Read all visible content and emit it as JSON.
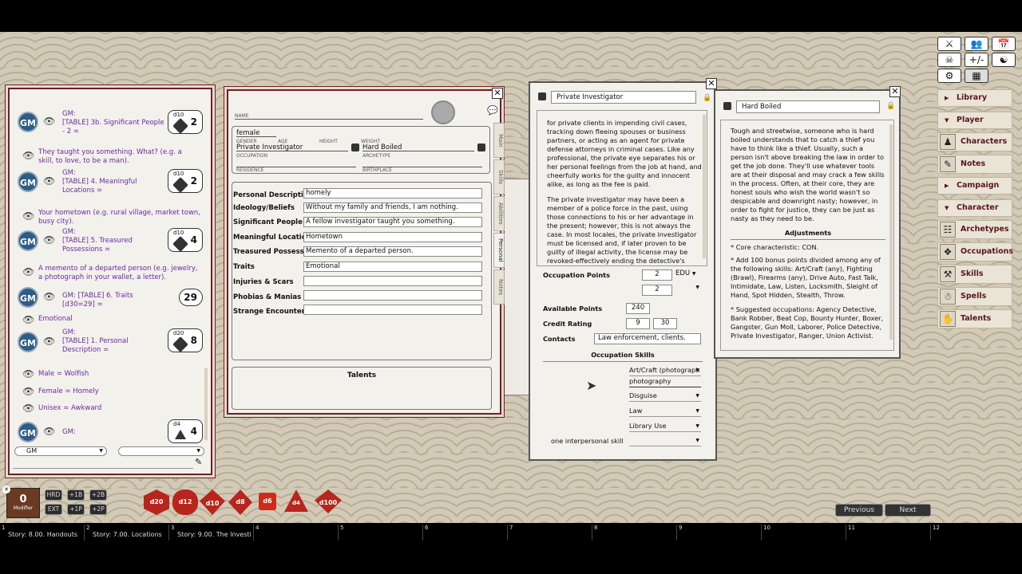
{
  "chat": {
    "lines": [
      {
        "speaker": "GM:",
        "text": "[TABLE] 3b. Significant People - 2 ="
      },
      {
        "text": "They taught you something. What? (e.g. a skill, to love, to be a man)."
      },
      {
        "speaker": "GM:",
        "text": "[TABLE] 4. Meaningful Locations ="
      },
      {
        "text": "Your hometown (e.g. rural village, market town, busy city)."
      },
      {
        "speaker": "GM:",
        "text": "[TABLE] 5. Treasured Possessions ="
      },
      {
        "text": "A memento of a departed person (e.g. jewelry, a photograph in your wallet, a letter)."
      },
      {
        "speaker": "GM:",
        "text": "[TABLE] 6. Traits [d30=29] ="
      },
      {
        "text": "Emotional"
      },
      {
        "speaker": "GM:",
        "text": "[TABLE] 1. Personal Description ="
      },
      {
        "text": "Male = Wolfish"
      },
      {
        "text": "Female = Homely"
      },
      {
        "text": "Unisex = Awkward"
      },
      {
        "speaker": "GM:",
        "text": ""
      }
    ],
    "dice": [
      {
        "die": "d10",
        "value": "2"
      },
      {
        "die": "d10",
        "value": "2"
      },
      {
        "die": "d10",
        "value": "4"
      },
      {
        "die": "",
        "value": "29"
      },
      {
        "die": "d20",
        "value": "8"
      },
      {
        "die": "d4",
        "value": "4"
      }
    ],
    "gm_badge": "GM",
    "identity_select": "GM",
    "mode_select": ""
  },
  "sheet": {
    "name_label": "NAME",
    "gender": "female",
    "gender_label": "GENDER",
    "age_label": "AGE",
    "height_label": "HEIGHT",
    "weight_label": "WEIGHT",
    "occupation": "Private Investigator",
    "occupation_label": "OCCUPATION",
    "archetype": "Hard Boiled",
    "archetype_label": "ARCHETYPE",
    "residence_label": "RESIDENCE",
    "birthplace_label": "BIRTHPLACE",
    "tabs": [
      "Main",
      "Skills",
      "Abilities",
      "Personal",
      "Notes"
    ],
    "rows": [
      {
        "label": "Personal Description",
        "value": "homely"
      },
      {
        "label": "Ideology/Beliefs",
        "value": "Without my family and friends, I am nothing."
      },
      {
        "label": "Significant People",
        "value": "A fellow investigator taught you something."
      },
      {
        "label": "Meaningful Locations",
        "value": "Hometown"
      },
      {
        "label": "Treasured Possessions",
        "value": "Memento of a departed person."
      },
      {
        "label": "Traits",
        "value": "Emotional"
      },
      {
        "label": "Injuries & Scars",
        "value": ""
      },
      {
        "label": "Phobias & Manias",
        "value": ""
      },
      {
        "label": "Strange Encounters",
        "value": ""
      }
    ],
    "talents_title": "Talents"
  },
  "occupation": {
    "title": "Private Investigator",
    "para1": "for private clients in impending civil cases, tracking down fleeing spouses or business partners, or acting as an agent for private defense attorneys in criminal cases. Like any professional, the private eye separates his or her personal feelings from the job at hand, and cheerfully works for the guilty and innocent alike, as long as the fee is paid.",
    "para2": "The private investigator may have been a member of a police force in the past, using those connections to his or her advantage in the present; however, this is not always the case. In most locales, the private investigator must be licensed and, if later proven to be guilty of illegal activity, the license may be revoked-effectively ending the detective's career.",
    "occ_points_label": "Occupation Points",
    "occ_points_a": "2",
    "occ_points_a_stat": "EDU",
    "occ_points_b": "2",
    "occ_points_b_stat": "",
    "available_label": "Available Points",
    "available": "240",
    "credit_label": "Credit Rating",
    "credit_min": "9",
    "credit_max": "30",
    "contacts_label": "Contacts",
    "contacts": "Law enforcement, clients.",
    "skills_title": "Occupation Skills",
    "skills": [
      "Art/Craft (photograph",
      "photography",
      "Disguise",
      "Law",
      "Library Use"
    ],
    "interpersonal": "one interpersonal skill"
  },
  "archetype": {
    "title": "Hard Boiled",
    "desc": "Tough and streetwise, someone who is hard boiled understands that to catch a thief you have to think like a thief. Usually, such a person isn't above breaking the law in order to get the job done. They'll use whatever tools are at their disposal and may crack a few skills in the process. Often, at their core, they are honest souls who wish the world wasn't so despicable and downright nasty; however, in order to fight for justice, they can be just as nasty as they need to be.",
    "adj_title": "Adjustments",
    "adj1": "* Core characteristic: CON.",
    "adj2": "* Add 100 bonus points divided among any of the following skills: Art/Craft (any), Fighting (Brawl), Firearms (any), Drive Auto, Fast Talk, Intimidate, Law, Listen, Locksmith, Sleight of Hand, Spot Hidden, Stealth, Throw.",
    "adj3": "* Suggested occupations: Agency Detective, Bank Robber, Beat Cop, Bounty Hunter, Boxer, Gangster, Gun Moll, Laborer, Police Detective, Private Investigator, Ranger, Union Activist."
  },
  "sidebar": {
    "sections": [
      "Library",
      "Player",
      "Campaign",
      "Character"
    ],
    "player_items": [
      {
        "label": "Characters",
        "icon": "people-icon"
      },
      {
        "label": "Notes",
        "icon": "notes-icon"
      }
    ],
    "character_items": [
      {
        "label": "Archetypes",
        "icon": "archetype-icon"
      },
      {
        "label": "Occupations",
        "icon": "occupation-icon"
      },
      {
        "label": "Skills",
        "icon": "skills-icon"
      },
      {
        "label": "Spells",
        "icon": "spells-icon"
      },
      {
        "label": "Talents",
        "icon": "talents-icon"
      }
    ]
  },
  "modifiers": [
    "HRD",
    "+1B",
    "+2B",
    "EXT",
    "+1P",
    "+2P"
  ],
  "modifier_value": "0",
  "modifier_label": "Modifier",
  "dice_tray": [
    "d20",
    "d12",
    "d10",
    "d8",
    "d6",
    "d4",
    "d100"
  ],
  "nav": {
    "previous": "Previous",
    "next": "Next"
  },
  "hotkeys": [
    {
      "num": "1",
      "label": "Story: 8.00. Handouts"
    },
    {
      "num": "2",
      "label": "Story: 7.00. Locations"
    },
    {
      "num": "3",
      "label": "Story: 9.00. The Investi"
    },
    {
      "num": "4",
      "label": ""
    },
    {
      "num": "5",
      "label": ""
    },
    {
      "num": "6",
      "label": ""
    },
    {
      "num": "7",
      "label": ""
    },
    {
      "num": "8",
      "label": ""
    },
    {
      "num": "9",
      "label": ""
    },
    {
      "num": "10",
      "label": ""
    },
    {
      "num": "11",
      "label": ""
    },
    {
      "num": "12",
      "label": ""
    }
  ]
}
